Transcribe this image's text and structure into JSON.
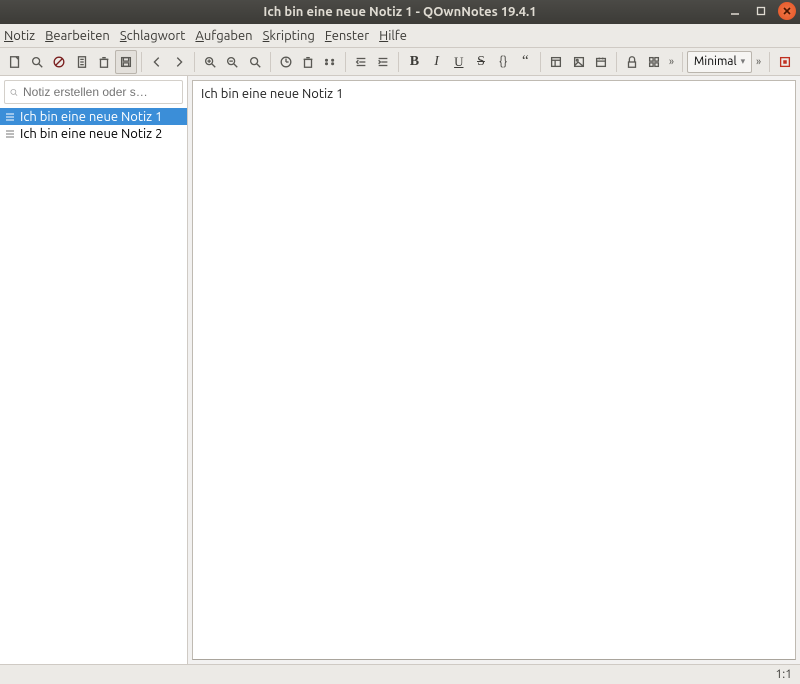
{
  "window": {
    "title": "Ich bin eine neue Notiz 1 - QOwnNotes 19.4.1"
  },
  "menu": {
    "items": [
      "Notiz",
      "Bearbeiten",
      "Schlagwort",
      "Aufgaben",
      "Skripting",
      "Fenster",
      "Hilfe"
    ]
  },
  "toolbar": {
    "overflow1": "»",
    "overflow2": "»",
    "mode_selector": "Minimal"
  },
  "sidebar": {
    "search_placeholder": "Notiz erstellen oder s…",
    "notes": [
      {
        "label": "Ich bin eine neue Notiz 1",
        "selected": true
      },
      {
        "label": "Ich bin eine neue Notiz 2",
        "selected": false
      }
    ]
  },
  "editor": {
    "content": "Ich bin eine neue Notiz 1"
  },
  "statusbar": {
    "cursor": "1:1"
  }
}
